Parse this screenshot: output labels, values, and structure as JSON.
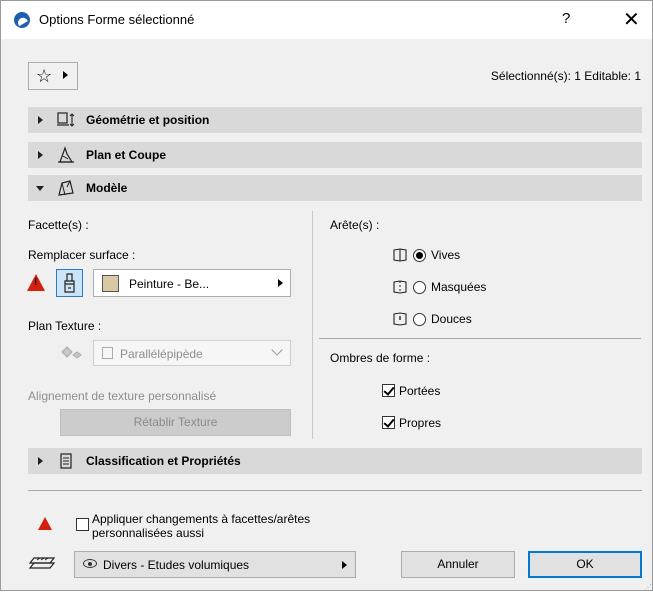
{
  "window": {
    "title": "Options Forme sélectionné",
    "help_label": "?",
    "close_label": "✕"
  },
  "toolbar": {
    "favorites_icon": "star-icon",
    "selection_status": "Sélectionné(s): 1 Editable: 1"
  },
  "panels": [
    {
      "label": "Géométrie et position",
      "expanded": false,
      "icon": "geometry-icon"
    },
    {
      "label": "Plan et Coupe",
      "expanded": false,
      "icon": "plan-section-icon"
    },
    {
      "label": "Modèle",
      "expanded": true,
      "icon": "model-icon"
    },
    {
      "label": "Classification et Propriétés",
      "expanded": false,
      "icon": "classification-icon"
    }
  ],
  "model": {
    "faces_label": "Facette(s) :",
    "override_surface_label": "Remplacer surface :",
    "surface_value": "Peinture - Be...",
    "surface_color": "#d9c9a3",
    "texture_plan_label": "Plan Texture :",
    "texture_plan_value": "Parallélépipède",
    "custom_alignment_label": "Alignement de texture personnalisé",
    "reset_texture_label": "Rétablir Texture",
    "edges_label": "Arête(s) :",
    "edges": [
      {
        "label": "Vives",
        "selected": true
      },
      {
        "label": "Masquées",
        "selected": false
      },
      {
        "label": "Douces",
        "selected": false
      }
    ],
    "shadows_label": "Ombres de forme :",
    "shadows": [
      {
        "label": "Portées",
        "checked": true
      },
      {
        "label": "Propres",
        "checked": true
      }
    ]
  },
  "footer": {
    "apply_changes_label_line1": "Appliquer changements à facettes/arêtes",
    "apply_changes_label_line2": "personnalisées aussi",
    "apply_changes_checked": false,
    "layer_value": "Divers - Etudes volumiques",
    "cancel_label": "Annuler",
    "ok_label": "OK"
  },
  "colors": {
    "warning": "#d4200f",
    "accent": "#0078d7"
  }
}
